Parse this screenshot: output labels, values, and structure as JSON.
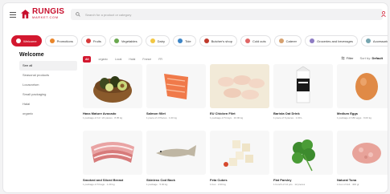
{
  "header": {
    "logo_name": "RUNGIS",
    "logo_sub": "MARKET.COM",
    "search_placeholder": "Search for a product or category"
  },
  "categories": [
    {
      "label": "Welcome",
      "active": true,
      "color": "#ffffff"
    },
    {
      "label": "Promotions",
      "active": false,
      "color": "#e9862b"
    },
    {
      "label": "Fruits",
      "active": false,
      "color": "#d63a3a"
    },
    {
      "label": "Vegetables",
      "active": false,
      "color": "#6aa84f"
    },
    {
      "label": "Dairy",
      "active": false,
      "color": "#f2c744"
    },
    {
      "label": "Tide",
      "active": false,
      "color": "#3d85c6"
    },
    {
      "label": "Butcher's shop",
      "active": false,
      "color": "#c0392b"
    },
    {
      "label": "Cold cuts",
      "active": false,
      "color": "#e06666"
    },
    {
      "label": "Caterer",
      "active": false,
      "color": "#d6a16f"
    },
    {
      "label": "Groceries and beverages",
      "active": false,
      "color": "#8e7cc3"
    },
    {
      "label": "Accessories and equipment",
      "active": false,
      "color": "#76a5af"
    },
    {
      "label": "Lemongrass",
      "active": false,
      "color": "#93c47d"
    }
  ],
  "sidebar": {
    "title": "Welcome",
    "items": [
      {
        "label": "See all",
        "active": true
      },
      {
        "label": "Seasonal products",
        "active": false
      },
      {
        "label": "Locavorism",
        "active": false
      },
      {
        "label": "Small packaging",
        "active": false
      },
      {
        "label": "Halal",
        "active": false
      },
      {
        "label": "organic",
        "active": false
      }
    ]
  },
  "filters": {
    "chips": [
      "All",
      "organic",
      "Local",
      "Halal",
      "France",
      "FR"
    ],
    "filter_label": "Filter",
    "sort_prefix": "Sort by:",
    "sort_value": "Default"
  },
  "products": [
    {
      "name": "Hass Mature Avocado",
      "meta": "1 package of 12 / 24 pieces · 8.05 kg",
      "image": "avocado"
    },
    {
      "name": "Salmon fillet",
      "meta": "1 piece of 2 Pieces · 1.00 kg",
      "image": "salmon"
    },
    {
      "name": "EU Chicken Filet",
      "meta": "1 package of 5 trays · 10.00 kg",
      "image": "chicken"
    },
    {
      "name": "Barista Oat Drink",
      "meta": "1 piece of 6 pieces · 1.00 L",
      "image": "milk"
    },
    {
      "name": "Medium Eggs",
      "meta": "1 package of 180 eggs · 9.00 kg",
      "image": "eggs"
    },
    {
      "name": "Smoked and Sliced Breast",
      "meta": "1 package of 6 bags · 1.20 kg",
      "image": "bacon"
    },
    {
      "name": "Skinless Cod Back",
      "meta": "1 package · 5.00 kg",
      "image": "cod"
    },
    {
      "name": "Feta Cubes",
      "meta": "1 box · 2.00 kg",
      "image": "feta"
    },
    {
      "name": "Flat Parsley",
      "meta": "1 bunch of 12 pcs · 12 pieces",
      "image": "parsley"
    },
    {
      "name": "Natural Tuna",
      "meta": "1 box of 4x4 · 400 gr",
      "image": "tuna"
    }
  ],
  "colors": {
    "brand": "#d3182f",
    "background": "#f3f3f4"
  }
}
